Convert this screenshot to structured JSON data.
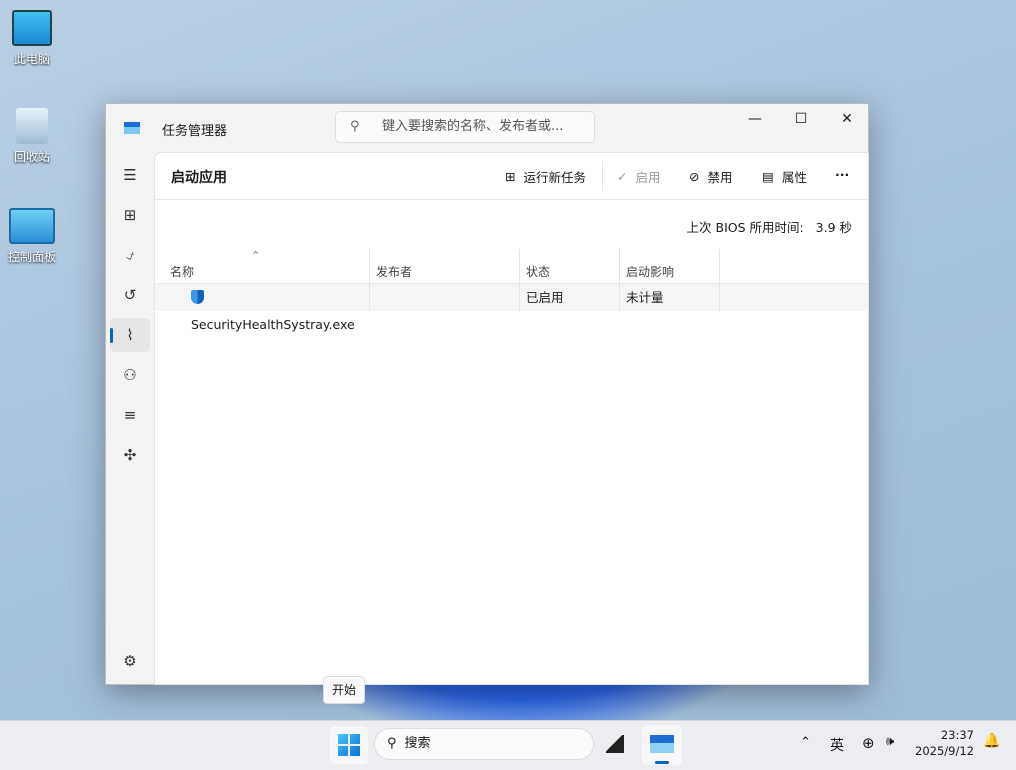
{
  "desktop": {
    "icons": [
      {
        "label": "此电脑"
      },
      {
        "label": "回收站"
      },
      {
        "label": "控制面板"
      }
    ]
  },
  "window": {
    "title": "任务管理器",
    "search_placeholder": "键入要搜索的名称、发布者或...",
    "controls": {
      "minimize": "—",
      "maximize": "☐",
      "close": "✕"
    }
  },
  "sidebar": {
    "items": [
      {
        "icon": "menu-icon",
        "glyph": "☰"
      },
      {
        "icon": "processes-icon",
        "glyph": "⊞"
      },
      {
        "icon": "performance-icon",
        "glyph": "⍻"
      },
      {
        "icon": "app-history-icon",
        "glyph": "↺"
      },
      {
        "icon": "startup-apps-icon",
        "glyph": "⌇"
      },
      {
        "icon": "users-icon",
        "glyph": "⚇"
      },
      {
        "icon": "details-icon",
        "glyph": "≡"
      },
      {
        "icon": "services-icon",
        "glyph": "✣"
      },
      {
        "icon": "settings-icon",
        "glyph": "⚙"
      }
    ]
  },
  "page": {
    "title": "启动应用",
    "toolbar": {
      "run_new_task": "运行新任务",
      "enable": "启用",
      "disable": "禁用",
      "properties": "属性",
      "more": "···"
    },
    "bios_label": "上次 BIOS 所用时间:",
    "bios_value": "3.9 秒",
    "columns": [
      "名称",
      "发布者",
      "状态",
      "启动影响"
    ],
    "rows": [
      {
        "name": "SecurityHealthSystray.exe",
        "publisher": "",
        "status": "已启用",
        "impact": "未计量"
      }
    ]
  },
  "tooltip": "开始",
  "taskbar": {
    "search": "搜索",
    "ime": "英",
    "time": "23:37",
    "date": "2025/9/12"
  }
}
